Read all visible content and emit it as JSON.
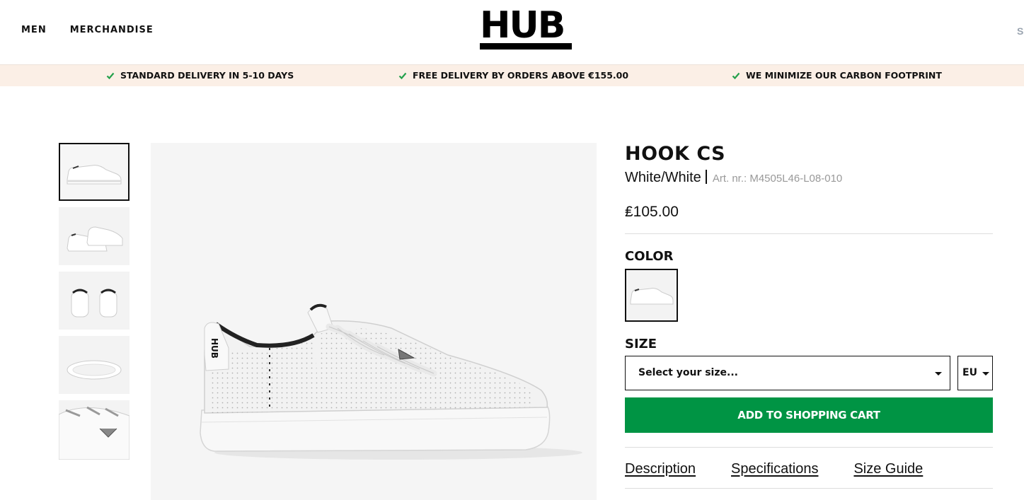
{
  "header": {
    "nav": [
      "MEN",
      "MERCHANDISE"
    ],
    "logo": "HUB",
    "search_cut": "S"
  },
  "usp": [
    "STANDARD DELIVERY IN 5-10 DAYS",
    "FREE DELIVERY BY ORDERS ABOVE €155.00",
    "WE MINIMIZE OUR CARBON FOOTPRINT"
  ],
  "product": {
    "title": "HOOK CS",
    "color_name": "White/White",
    "art_nr": "Art. nr.: M4505L46-L08-010",
    "price": "₤105.00",
    "color_label": "COLOR",
    "size_label": "SIZE",
    "size_placeholder": "Select your size...",
    "size_unit": "EU",
    "add_to_cart": "ADD TO SHOPPING CART",
    "tabs": [
      "Description",
      "Specifications",
      "Size Guide"
    ]
  },
  "colors": {
    "check": "#22a04b",
    "cart_button": "#009444",
    "usp_background": "#fbefe6"
  }
}
